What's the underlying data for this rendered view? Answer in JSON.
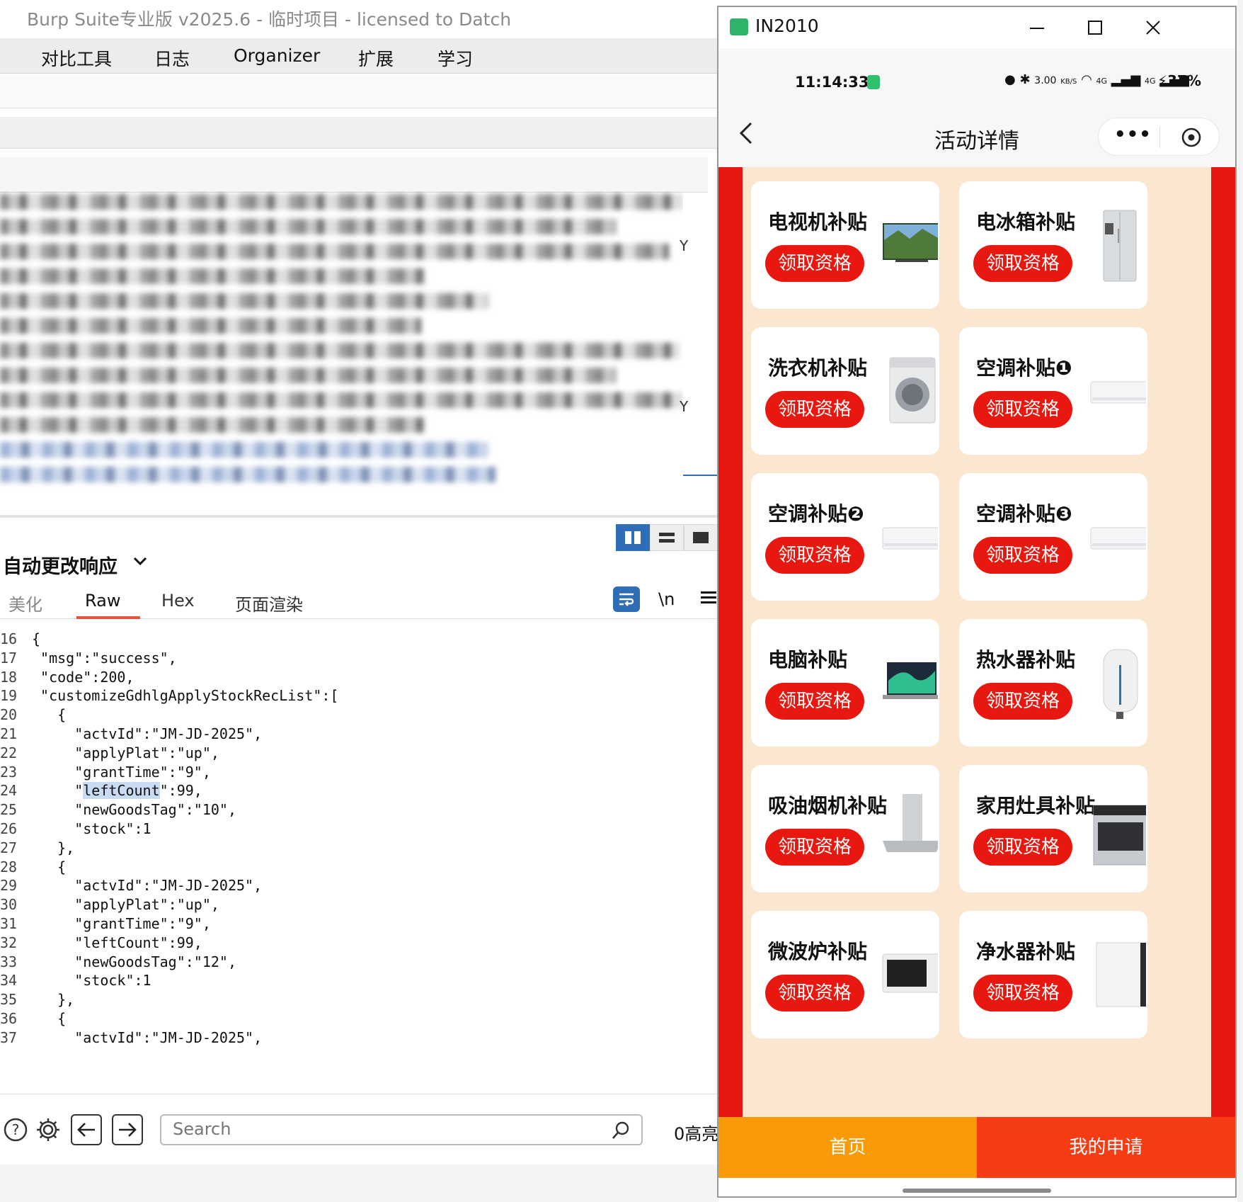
{
  "burp": {
    "title": "Burp Suite专业版  v2025.6 - 临时项目 - licensed to Datch",
    "menu": [
      "对比工具",
      "日志",
      "Organizer",
      "扩展",
      "学习"
    ],
    "blur_marks": [
      "Y",
      "Y"
    ],
    "response_panel": {
      "title": "自动更改响应",
      "tabs": [
        "美化",
        "Raw",
        "Hex",
        "页面渲染"
      ],
      "active_tab": "Raw",
      "newline_label": "\\n"
    },
    "code_lines": [
      {
        "n": "16",
        "t": "{"
      },
      {
        "n": "17",
        "t": " \"msg\":\"success\","
      },
      {
        "n": "18",
        "t": " \"code\":200,"
      },
      {
        "n": "19",
        "t": " \"customizeGdhlgApplyStockRecList\":["
      },
      {
        "n": "20",
        "t": "   {"
      },
      {
        "n": "21",
        "t": "     \"actvId\":\"JM-JD-2025\","
      },
      {
        "n": "22",
        "t": "     \"applyPlat\":\"up\","
      },
      {
        "n": "23",
        "t": "     \"grantTime\":\"9\","
      },
      {
        "n": "24",
        "pre": "     \"",
        "hl": "leftCount",
        "post": "\":99,"
      },
      {
        "n": "25",
        "t": "     \"newGoodsTag\":\"10\","
      },
      {
        "n": "26",
        "t": "     \"stock\":1"
      },
      {
        "n": "27",
        "t": "   },"
      },
      {
        "n": "28",
        "t": "   {"
      },
      {
        "n": "29",
        "t": "     \"actvId\":\"JM-JD-2025\","
      },
      {
        "n": "30",
        "t": "     \"applyPlat\":\"up\","
      },
      {
        "n": "31",
        "t": "     \"grantTime\":\"9\","
      },
      {
        "n": "32",
        "t": "     \"leftCount\":99,"
      },
      {
        "n": "33",
        "t": "     \"newGoodsTag\":\"12\","
      },
      {
        "n": "34",
        "t": "     \"stock\":1"
      },
      {
        "n": "35",
        "t": "   },"
      },
      {
        "n": "36",
        "t": "   {"
      },
      {
        "n": "37",
        "t": "     \"actvId\":\"JM-JD-2025\","
      }
    ],
    "search": {
      "placeholder": "Search"
    },
    "highlight_count": "0高亮"
  },
  "phone": {
    "window_title": "IN2010",
    "status": {
      "time": "11:14:33",
      "speed": "3.00",
      "speed_unit": "KB/S",
      "net1": "4G",
      "net2": "4G",
      "battery": "37%"
    },
    "page_title": "活动详情",
    "button_label": "领取资格",
    "cards": [
      {
        "title": "电视机补贴",
        "icon": "tv-icon"
      },
      {
        "title": "电冰箱补贴",
        "icon": "fridge-icon"
      },
      {
        "title": "洗衣机补贴",
        "icon": "washer-icon"
      },
      {
        "title": "空调补贴❶",
        "icon": "ac-icon"
      },
      {
        "title": "空调补贴❷",
        "icon": "ac-icon"
      },
      {
        "title": "空调补贴❸",
        "icon": "ac-icon"
      },
      {
        "title": "电脑补贴",
        "icon": "laptop-icon"
      },
      {
        "title": "热水器补贴",
        "icon": "water-heater-icon"
      },
      {
        "title": "吸油烟机补贴",
        "icon": "range-hood-icon"
      },
      {
        "title": "家用灶具补贴",
        "icon": "stove-icon"
      },
      {
        "title": "微波炉补贴",
        "icon": "microwave-icon"
      },
      {
        "title": "净水器补贴",
        "icon": "water-purifier-icon"
      }
    ],
    "tabbar": {
      "home": "首页",
      "mine": "我的申请"
    },
    "colors": {
      "primary_red": "#e8170f",
      "tab_orange": "#fb9a07",
      "tab_red": "#f53c15",
      "card_bg": "#fbe6cf",
      "burp_blue": "#2f6db5",
      "tab_accent": "#e8533a"
    }
  }
}
